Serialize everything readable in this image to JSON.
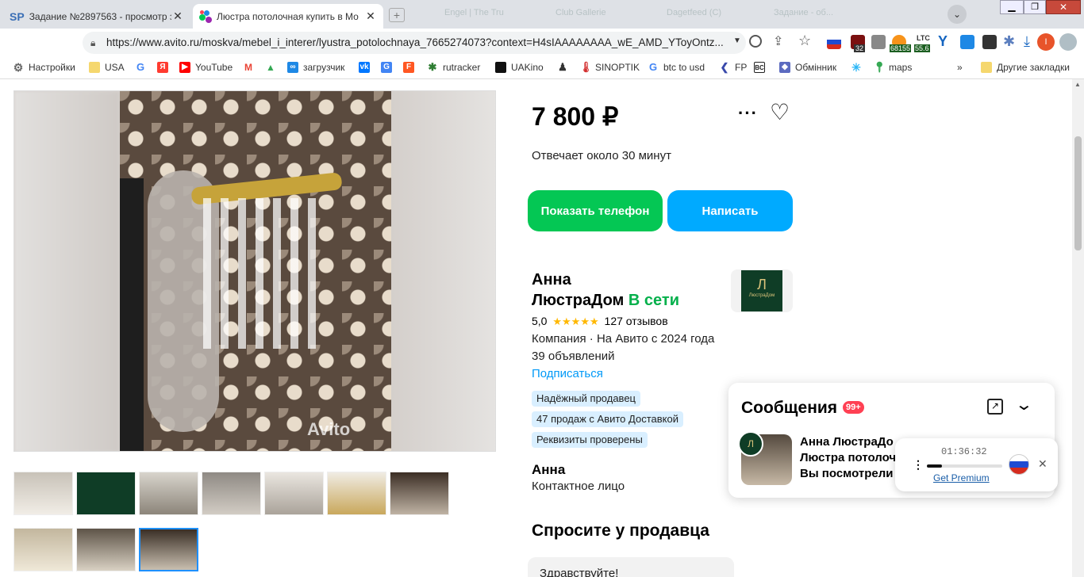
{
  "tabs": [
    {
      "favicon": "SP",
      "title": "Задание №2897563 - просмотр з"
    },
    {
      "favicon": "avito-icon",
      "title": "Люстра потолочная купить в Мо"
    }
  ],
  "ghost_tabs": [
    "Engel | The Tru",
    "Сlub Gallerie",
    "Dagetfeed (C)",
    "Задание - об..."
  ],
  "url": "https://www.avito.ru/moskva/mebel_i_interer/lyustra_potolochnaya_7665274073?context=H4sIAAAAAAAA_wE_AMD_YToyOntz...",
  "extensions": {
    "badge_count": "32",
    "btc_value": "68155",
    "ltc_label": "LTC",
    "ltc_value": "55.6",
    "profile_letter": "I"
  },
  "bookmarks": [
    {
      "label": "Настройки",
      "color": "#666"
    },
    {
      "label": "USA",
      "color": "#f5c518"
    },
    {
      "label": "",
      "color": "#4285f4"
    },
    {
      "label": "",
      "color": "#ff3b30"
    },
    {
      "label": "YouTube",
      "color": "#ff0000"
    },
    {
      "label": "",
      "color": "#ea4335"
    },
    {
      "label": "",
      "color": "#34a853"
    },
    {
      "label": "загрузчик",
      "color": "#1e88e5"
    },
    {
      "label": "",
      "color": "#0077ff"
    },
    {
      "label": "",
      "color": "#4285f4"
    },
    {
      "label": "",
      "color": "#ff5722"
    },
    {
      "label": "rutracker",
      "color": "#2e7d32"
    },
    {
      "label": "UAKino",
      "color": "#111"
    },
    {
      "label": "",
      "color": "#333"
    },
    {
      "label": "SINOPTIK",
      "color": "#1565c0"
    },
    {
      "label": "btc to usd",
      "color": "#4285f4"
    },
    {
      "label": "FP",
      "color": "#3949ab"
    },
    {
      "label": "",
      "color": "#222"
    },
    {
      "label": "Обмінник",
      "color": "#5c6bc0"
    },
    {
      "label": "",
      "color": "#29b6f6"
    },
    {
      "label": "maps",
      "color": "#34a853"
    }
  ],
  "bookmarks_more": "»",
  "other_bookmarks": "Другие закладки",
  "listing": {
    "price": "7 800 ₽",
    "response_time": "Отвечает около 30 минут",
    "show_phone": "Показать телефон",
    "write": "Написать",
    "watermark": "Avito",
    "seller": {
      "name_line1": "Анна",
      "name_line2": "ЛюстраДом",
      "online": "В сети",
      "rating": "5,0",
      "stars": "★★★★★",
      "reviews": "127 отзывов",
      "company": "Компания · На Авито с 2024 года",
      "ads": "39 объявлений",
      "subscribe": "Подписаться",
      "logo_text": "ЛюстраДом",
      "logo_letter": "Л"
    },
    "badges": [
      "Надёжный продавец",
      "47 продаж с Авито Доставкой",
      "Реквизиты проверены"
    ],
    "contact": {
      "name": "Анна",
      "role": "Контактное лицо"
    },
    "ask_title": "Спросите у продавца",
    "ask_message": "Здравствуйте!"
  },
  "messages": {
    "title": "Сообщения",
    "count": "99+",
    "item": {
      "line1": "Анна ЛюстраДо",
      "line2": "Люстра потолоч",
      "line3": "Вы посмотрели"
    }
  },
  "player": {
    "time": "01:36:32",
    "cta": "Get Premium",
    "progress": 0.2
  }
}
